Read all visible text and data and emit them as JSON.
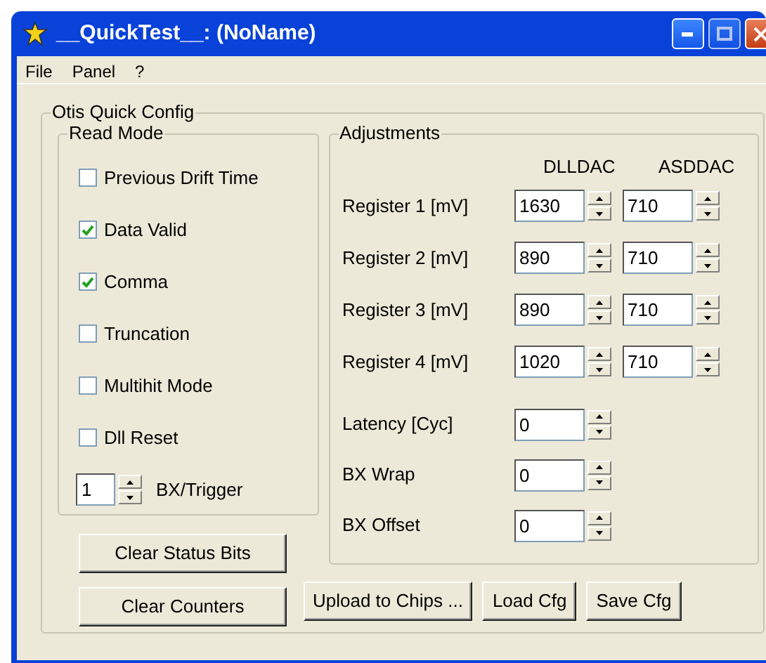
{
  "window": {
    "title": "__QuickTest__: (NoName)"
  },
  "menu": [
    "File",
    "Panel",
    "?"
  ],
  "config": {
    "title": "Otis Quick Config",
    "read_mode": {
      "title": "Read Mode",
      "options": [
        {
          "label": "Previous Drift Time",
          "checked": false
        },
        {
          "label": "Data Valid",
          "checked": true
        },
        {
          "label": "Comma",
          "checked": true
        },
        {
          "label": "Truncation",
          "checked": false
        },
        {
          "label": "Multihit Mode",
          "checked": false
        },
        {
          "label": "Dll Reset",
          "checked": false
        }
      ],
      "bx_trigger": {
        "value": "1",
        "label": "BX/Trigger"
      }
    },
    "adjustments": {
      "title": "Adjustments",
      "columns": [
        "DLLDAC",
        "ASDDAC"
      ],
      "registers": [
        {
          "label": "Register 1 [mV]",
          "values": [
            "1630",
            "710"
          ]
        },
        {
          "label": "Register 2 [mV]",
          "values": [
            "890",
            "710"
          ]
        },
        {
          "label": "Register 3 [mV]",
          "values": [
            "890",
            "710"
          ]
        },
        {
          "label": "Register 4 [mV]",
          "values": [
            "1020",
            "710"
          ]
        }
      ],
      "params": [
        {
          "label": "Latency [Cyc]",
          "value": "0"
        },
        {
          "label": "BX Wrap",
          "value": "0"
        },
        {
          "label": "BX Offset",
          "value": "0"
        }
      ]
    },
    "buttons_left": [
      "Clear Status Bits",
      "Clear Counters"
    ],
    "buttons_right": [
      "Upload to Chips ...",
      "Load Cfg",
      "Save Cfg"
    ]
  }
}
